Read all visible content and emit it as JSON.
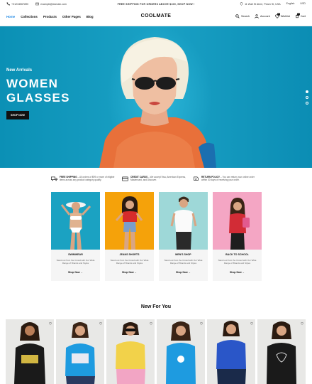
{
  "topbar": {
    "phone": "+01234567890",
    "email": "example@domain.com",
    "promo": "FREE SHIPPING FOR ORDERS ABOVE $100, SHOP NOW !",
    "address": "11 Wall St Ahmr, Pearn St, USA",
    "language": "English",
    "currency": "USD"
  },
  "header": {
    "logo": "COOLMATE",
    "nav": [
      "Home",
      "Collections",
      "Products",
      "Other Pages",
      "Blog"
    ],
    "search": "Search",
    "account": "Account",
    "wishlist": "Wishlist",
    "wishlist_count": "0",
    "cart": "Cart",
    "cart_count": "0"
  },
  "hero": {
    "subtitle": "New Arrivals",
    "title": "WOMEN GLASSES",
    "button": "SHOP NOW"
  },
  "features": [
    {
      "title": "FREE SHIPPING",
      "text": "All orders of $99 or more of eligible items across any product category qualify.",
      "icon": "truck-icon"
    },
    {
      "title": "CREDIT CARDS",
      "text": "We accept Visa, American Express, Mastercard, and Discover.",
      "icon": "credit-card-icon"
    },
    {
      "title": "RETURN POLICY",
      "text": "You can return your online order within 30 days of receiving your order.",
      "icon": "return-icon"
    }
  ],
  "categories": [
    {
      "name": "SWIMWEAR",
      "desc": "Stand out from the Crowd with Our Wide Range of Brands and Styles",
      "link": "Shop Now",
      "bg": "#1ba2c2"
    },
    {
      "name": "JEANS SHORTS",
      "desc": "Stand out from the Crowd with Our Wide Range of Brands and Styles",
      "link": "Shop Now",
      "bg": "#f5a20a"
    },
    {
      "name": "MEN'S SHOP",
      "desc": "Stand out from the Crowd with Our Wide Range of Brands and Styles",
      "link": "Shop Now",
      "bg": "#9ed8d8"
    },
    {
      "name": "BACK TO SCHOOL",
      "desc": "Stand out from the Crowd with Our Wide Range of Brands and Styles",
      "link": "Shop Now",
      "bg": "#f4a6c4"
    }
  ],
  "new_for_you": {
    "title": "New For You",
    "products": [
      {
        "shirt": "#1a1a1a",
        "pants": "#1a2a4a"
      },
      {
        "shirt": "#1e9be0",
        "pants": "#2a3a60"
      },
      {
        "shirt": "#f2d24a",
        "pants": "#f2a5c4"
      },
      {
        "shirt": "#1e9be0",
        "pants": "#d0d0d0"
      },
      {
        "shirt": "#2a56c8",
        "pants": "#1a2a4a"
      },
      {
        "shirt": "#1a1a1a",
        "pants": "#1a1a1a"
      }
    ]
  },
  "colors": {
    "accent": "#1e88e5",
    "hero": "#1aa1c5"
  }
}
